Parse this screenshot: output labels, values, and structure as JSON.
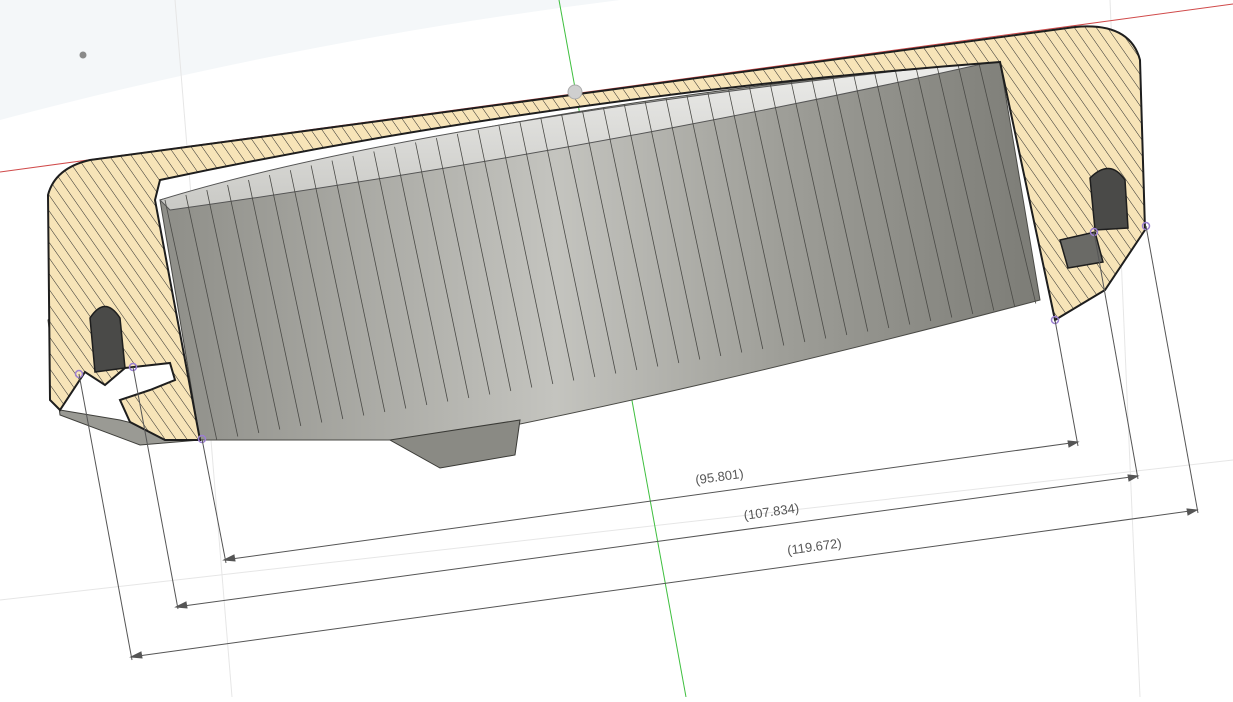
{
  "viewport": {
    "colors": {
      "background": "#ffffff",
      "hatch_fill": "#f7e4b8",
      "hatch_line": "#2b2b2b",
      "mesh_surface": "#a9a9a3",
      "mesh_line": "#4a4a46",
      "axis_x": "#d04a4a",
      "axis_y": "#3fbf3f",
      "dimension_line": "#555555",
      "point_marker": "#9b7fd1"
    },
    "dimensions": [
      {
        "label": "(95.801)"
      },
      {
        "label": "(107.834)"
      },
      {
        "label": "(119.672)"
      }
    ]
  }
}
